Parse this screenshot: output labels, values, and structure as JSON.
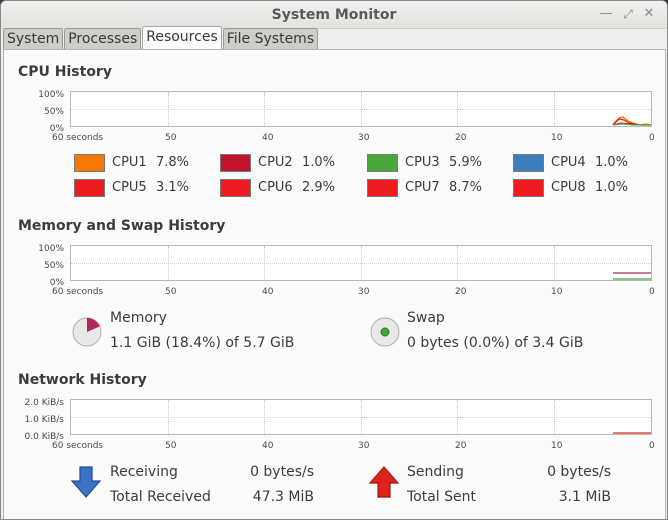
{
  "window": {
    "title": "System Monitor"
  },
  "tabs": [
    {
      "label": "System",
      "active": false
    },
    {
      "label": "Processes",
      "active": false
    },
    {
      "label": "Resources",
      "active": true
    },
    {
      "label": "File Systems",
      "active": false
    }
  ],
  "x_axis": {
    "start": "60 seconds",
    "ticks": [
      "50",
      "40",
      "30",
      "20",
      "10",
      "0"
    ]
  },
  "cpu": {
    "title": "CPU History",
    "y_ticks": [
      "100%",
      "50%",
      "0%"
    ],
    "items": [
      {
        "name": "CPU1",
        "value": "7.8%",
        "color": "#f57900"
      },
      {
        "name": "CPU2",
        "value": "1.0%",
        "color": "#c2152d"
      },
      {
        "name": "CPU3",
        "value": "5.9%",
        "color": "#4aa73a"
      },
      {
        "name": "CPU4",
        "value": "1.0%",
        "color": "#3b7fbd"
      },
      {
        "name": "CPU5",
        "value": "3.1%",
        "color": "#ee1c1c"
      },
      {
        "name": "CPU6",
        "value": "2.9%",
        "color": "#ee1c1c"
      },
      {
        "name": "CPU7",
        "value": "8.7%",
        "color": "#ee1c1c"
      },
      {
        "name": "CPU8",
        "value": "1.0%",
        "color": "#ee1c1c"
      }
    ]
  },
  "memory": {
    "title": "Memory and Swap History",
    "y_ticks": [
      "100%",
      "50%",
      "0%"
    ],
    "memory_label": "Memory",
    "memory_value": "1.1 GiB (18.4%) of 5.7 GiB",
    "memory_fraction": 0.184,
    "memory_color": "#b5275a",
    "swap_label": "Swap",
    "swap_value": "0 bytes (0.0%) of 3.4 GiB",
    "swap_fraction": 0.0,
    "swap_color": "#3fa63a"
  },
  "network": {
    "title": "Network History",
    "y_ticks": [
      "2.0 KiB/s",
      "1.0 KiB/s",
      "0.0 KiB/s"
    ],
    "receiving_label": "Receiving",
    "receiving_value": "0 bytes/s",
    "total_received_label": "Total Received",
    "total_received_value": "47.3 MiB",
    "sending_label": "Sending",
    "sending_value": "0 bytes/s",
    "total_sent_label": "Total Sent",
    "total_sent_value": "3.1 MiB",
    "receive_color": "#3a72c4",
    "send_color": "#e0231a"
  }
}
